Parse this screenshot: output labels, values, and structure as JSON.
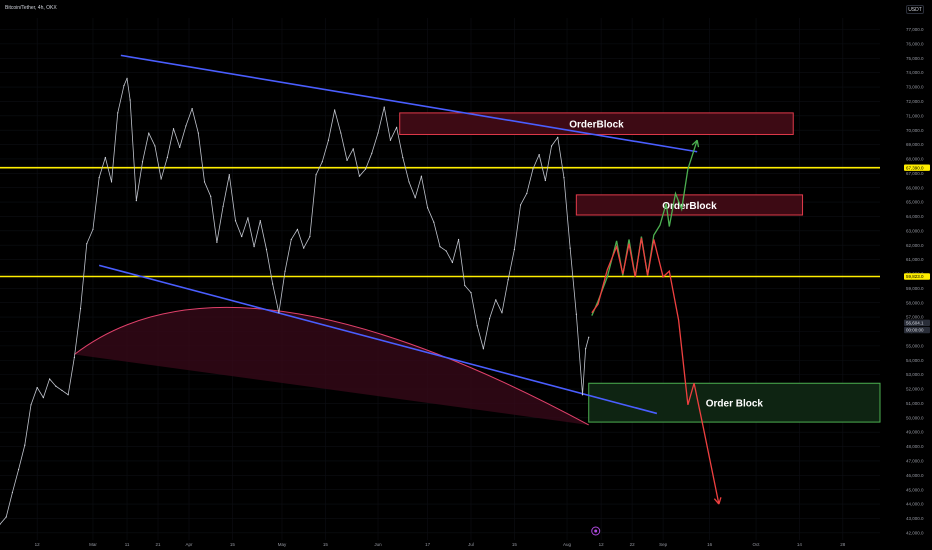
{
  "title": "Bitcoin/Tether, 4h, OKX",
  "unit_button": "USDT",
  "colors": {
    "background": "#000000",
    "trend_line": "#4a5eff",
    "level_line": "#ffee00",
    "ob_red_fill": "#3d0a14",
    "ob_red_stroke": "#e03a4a",
    "ob_green_fill": "#0e2412",
    "ob_green_stroke": "#4caf50",
    "path_green": "#4caf50",
    "path_red": "#ef4040",
    "arc_fill": "#3a0a1a",
    "arc_stroke": "#e0406a"
  },
  "chart_data": {
    "type": "line",
    "title": "Bitcoin/Tether, 4h, OKX",
    "y_axis_ticks": [
      "42,000.0",
      "43,000.0",
      "44,000.0",
      "45,000.0",
      "46,000.0",
      "47,000.0",
      "48,000.0",
      "49,000.0",
      "50,000.0",
      "51,000.0",
      "52,000.0",
      "53,000.0",
      "54,000.0",
      "55,000.0",
      "56,000.0",
      "57,000.0",
      "58,000.0",
      "59,000.0",
      "60,000.0",
      "61,000.0",
      "62,000.0",
      "63,000.0",
      "64,000.0",
      "65,000.0",
      "66,000.0",
      "67,000.0",
      "68,000.0",
      "69,000.0",
      "70,000.0",
      "71,000.0",
      "72,000.0",
      "73,000.0",
      "74,000.0",
      "75,000.0",
      "76,000.0",
      "77,000.0"
    ],
    "ylim": [
      41500,
      77800
    ],
    "x_axis_ticks": [
      {
        "label": "12",
        "t": 12
      },
      {
        "label": "Mar",
        "t": 30
      },
      {
        "label": "11",
        "t": 41
      },
      {
        "label": "21",
        "t": 51
      },
      {
        "label": "Apr",
        "t": 61
      },
      {
        "label": "15",
        "t": 75
      },
      {
        "label": "May",
        "t": 91
      },
      {
        "label": "15",
        "t": 105
      },
      {
        "label": "Jun",
        "t": 122
      },
      {
        "label": "17",
        "t": 138
      },
      {
        "label": "Jul",
        "t": 152
      },
      {
        "label": "15",
        "t": 166
      },
      {
        "label": "Aug",
        "t": 183
      },
      {
        "label": "12",
        "t": 194
      },
      {
        "label": "22",
        "t": 204
      },
      {
        "label": "Sep",
        "t": 214
      },
      {
        "label": "16",
        "t": 229
      },
      {
        "label": "Oct",
        "t": 244
      },
      {
        "label": "14",
        "t": 258
      },
      {
        "label": "28",
        "t": 272
      }
    ],
    "xlim": [
      0,
      284
    ],
    "price_labels": [
      {
        "text": "67,390.0",
        "y": 67390,
        "style": "level"
      },
      {
        "text": "59,823.0",
        "y": 59823,
        "style": "level"
      },
      {
        "text": "56,604.1",
        "y": 56604,
        "style": "current"
      },
      {
        "text": "00:00:00",
        "y": 56100,
        "style": "current"
      }
    ],
    "price_series": [
      [
        0,
        42600
      ],
      [
        2,
        43100
      ],
      [
        4,
        44800
      ],
      [
        6,
        46400
      ],
      [
        8,
        48100
      ],
      [
        10,
        50900
      ],
      [
        12,
        52100
      ],
      [
        14,
        51400
      ],
      [
        16,
        52700
      ],
      [
        18,
        52200
      ],
      [
        20,
        51900
      ],
      [
        22,
        51600
      ],
      [
        24,
        54200
      ],
      [
        26,
        57600
      ],
      [
        28,
        62100
      ],
      [
        30,
        63100
      ],
      [
        32,
        66700
      ],
      [
        34,
        68100
      ],
      [
        36,
        66400
      ],
      [
        38,
        71200
      ],
      [
        40,
        73100
      ],
      [
        41,
        73600
      ],
      [
        42,
        72100
      ],
      [
        44,
        65100
      ],
      [
        46,
        67800
      ],
      [
        48,
        69800
      ],
      [
        50,
        68900
      ],
      [
        52,
        66600
      ],
      [
        54,
        68100
      ],
      [
        56,
        70100
      ],
      [
        58,
        68800
      ],
      [
        60,
        70300
      ],
      [
        62,
        71500
      ],
      [
        64,
        69800
      ],
      [
        66,
        66400
      ],
      [
        68,
        65400
      ],
      [
        70,
        62200
      ],
      [
        72,
        64700
      ],
      [
        74,
        66900
      ],
      [
        76,
        63700
      ],
      [
        78,
        62600
      ],
      [
        80,
        63900
      ],
      [
        82,
        61900
      ],
      [
        84,
        63700
      ],
      [
        86,
        61700
      ],
      [
        88,
        59300
      ],
      [
        90,
        57300
      ],
      [
        92,
        60200
      ],
      [
        94,
        62400
      ],
      [
        96,
        63100
      ],
      [
        98,
        61800
      ],
      [
        100,
        62600
      ],
      [
        102,
        66900
      ],
      [
        104,
        67800
      ],
      [
        106,
        69300
      ],
      [
        108,
        71400
      ],
      [
        110,
        69800
      ],
      [
        112,
        67900
      ],
      [
        114,
        68700
      ],
      [
        116,
        66800
      ],
      [
        118,
        67300
      ],
      [
        120,
        68400
      ],
      [
        122,
        69800
      ],
      [
        124,
        71600
      ],
      [
        126,
        69300
      ],
      [
        128,
        70200
      ],
      [
        130,
        68100
      ],
      [
        132,
        66400
      ],
      [
        134,
        65300
      ],
      [
        136,
        66800
      ],
      [
        138,
        64600
      ],
      [
        140,
        63600
      ],
      [
        142,
        61900
      ],
      [
        144,
        61600
      ],
      [
        146,
        60800
      ],
      [
        148,
        62400
      ],
      [
        150,
        59200
      ],
      [
        152,
        58700
      ],
      [
        154,
        56400
      ],
      [
        156,
        54800
      ],
      [
        158,
        56900
      ],
      [
        160,
        58200
      ],
      [
        162,
        57300
      ],
      [
        164,
        59600
      ],
      [
        166,
        61700
      ],
      [
        168,
        64800
      ],
      [
        170,
        65600
      ],
      [
        172,
        67300
      ],
      [
        174,
        68300
      ],
      [
        176,
        66500
      ],
      [
        178,
        68900
      ],
      [
        180,
        69500
      ],
      [
        182,
        66700
      ],
      [
        184,
        61800
      ],
      [
        186,
        57200
      ],
      [
        188,
        51600
      ],
      [
        189,
        54800
      ],
      [
        190,
        55600
      ]
    ],
    "drawings": {
      "trend_upper": [
        [
          39,
          75200
        ],
        [
          225,
          68500
        ]
      ],
      "trend_lower": [
        [
          32,
          60600
        ],
        [
          212,
          50300
        ]
      ],
      "level_upper": 67390,
      "level_lower": 59823,
      "arc": {
        "from": [
          24,
          54400
        ],
        "peak": [
          91,
          57400
        ],
        "to": [
          190,
          49500
        ]
      },
      "orderblocks": [
        {
          "label": "OrderBlock",
          "x0": 129,
          "x1": 256,
          "y0": 69700,
          "y1": 71200,
          "color": "red"
        },
        {
          "label": "OrderBlock",
          "x0": 186,
          "x1": 259,
          "y0": 64100,
          "y1": 65500,
          "color": "red"
        },
        {
          "label": "Order Block",
          "x0": 190,
          "x1": 284,
          "y0": 49700,
          "y1": 52400,
          "color": "green"
        }
      ],
      "projection_green": [
        [
          191,
          57100
        ],
        [
          193,
          58100
        ],
        [
          196,
          59800
        ],
        [
          199,
          62300
        ],
        [
          201,
          59900
        ],
        [
          203,
          62400
        ],
        [
          205,
          59800
        ],
        [
          207,
          62600
        ],
        [
          209,
          59900
        ],
        [
          211,
          62700
        ],
        [
          213,
          63400
        ],
        [
          215,
          64900
        ],
        [
          216,
          63300
        ],
        [
          218,
          65600
        ],
        [
          220,
          64500
        ],
        [
          222,
          67300
        ],
        [
          225,
          69300
        ]
      ],
      "projection_red": [
        [
          191,
          57300
        ],
        [
          193,
          57900
        ],
        [
          196,
          60300
        ],
        [
          199,
          61900
        ],
        [
          201,
          60000
        ],
        [
          203,
          62100
        ],
        [
          205,
          59800
        ],
        [
          207,
          62500
        ],
        [
          209,
          59900
        ],
        [
          211,
          62400
        ],
        [
          214,
          59800
        ],
        [
          216,
          60200
        ],
        [
          219,
          56800
        ],
        [
          222,
          50900
        ],
        [
          224,
          52400
        ],
        [
          227,
          49300
        ],
        [
          232,
          44000
        ]
      ]
    },
    "x_marker_at": 190
  }
}
